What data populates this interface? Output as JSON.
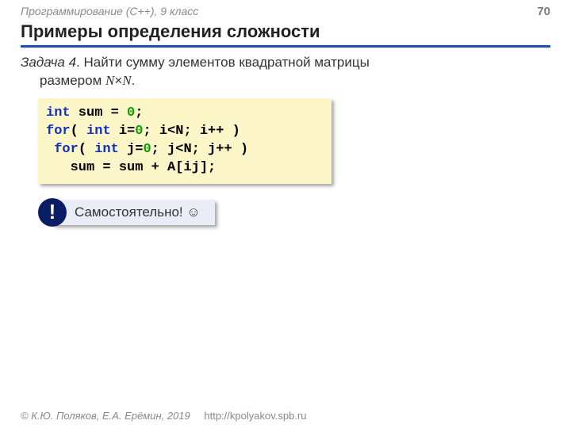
{
  "header": {
    "course": "Программирование (C++), 9 класс",
    "page": "70"
  },
  "title": "Примеры определения сложности",
  "task": {
    "head": "Задача 4",
    "body1": ". Найти сумму элементов квадратной матрицы",
    "body2_prefix": "размером ",
    "dim1": "N",
    "x": "×",
    "dim2": "N",
    "body2_suffix": "."
  },
  "code": {
    "l1_int": "int",
    "l1_a": " sum = ",
    "l1_zero": "0",
    "l1_b": ";",
    "l2_for": "for",
    "l2_a": "( ",
    "l2_int": "int",
    "l2_b": " i=",
    "l2_zero": "0",
    "l2_c": "; i<N; i++ )",
    "l3_pad": " ",
    "l3_for": "for",
    "l3_a": "( ",
    "l3_int": "int",
    "l3_b": " j=",
    "l3_zero": "0",
    "l3_c": "; j<N; j++ )",
    "l4": "   sum = sum + A[ij];"
  },
  "callout": {
    "bang": "!",
    "text": "Самостоятельно! ☺"
  },
  "footer": {
    "copyright": "© К.Ю. Поляков, Е.А. Ерёмин, 2019",
    "url": "http://kpolyakov.spb.ru"
  }
}
